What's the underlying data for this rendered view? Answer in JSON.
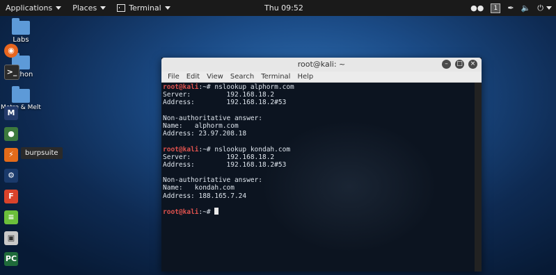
{
  "topbar": {
    "applications": "Applications",
    "places": "Places",
    "terminal": "Terminal",
    "clock": "Thu 09:52",
    "workspace": "1"
  },
  "desktop": {
    "icons": [
      {
        "label": "Labs"
      },
      {
        "label": "Python"
      },
      {
        "label": "Metre & Melt"
      }
    ]
  },
  "dock": {
    "tooltip": "burpsuite"
  },
  "window": {
    "title": "root@kali: ~",
    "menu": [
      "File",
      "Edit",
      "View",
      "Search",
      "Terminal",
      "Help"
    ]
  },
  "terminal": {
    "lines": [
      {
        "prompt": "root@kali",
        "rest": ":~# nslookup alphorm.com"
      },
      {
        "text": "Server:\t\t192.168.18.2"
      },
      {
        "text": "Address:\t192.168.18.2#53"
      },
      {
        "text": ""
      },
      {
        "text": "Non-authoritative answer:"
      },
      {
        "text": "Name:\talphorm.com"
      },
      {
        "text": "Address: 23.97.208.18"
      },
      {
        "text": ""
      },
      {
        "prompt": "root@kali",
        "rest": ":~# nslookup kondah.com"
      },
      {
        "text": "Server:\t\t192.168.18.2"
      },
      {
        "text": "Address:\t192.168.18.2#53"
      },
      {
        "text": ""
      },
      {
        "text": "Non-authoritative answer:"
      },
      {
        "text": "Name:\tkondah.com"
      },
      {
        "text": "Address: 188.165.7.24"
      },
      {
        "text": ""
      },
      {
        "prompt": "root@kali",
        "rest": ":~# ",
        "cursor": true
      }
    ]
  }
}
